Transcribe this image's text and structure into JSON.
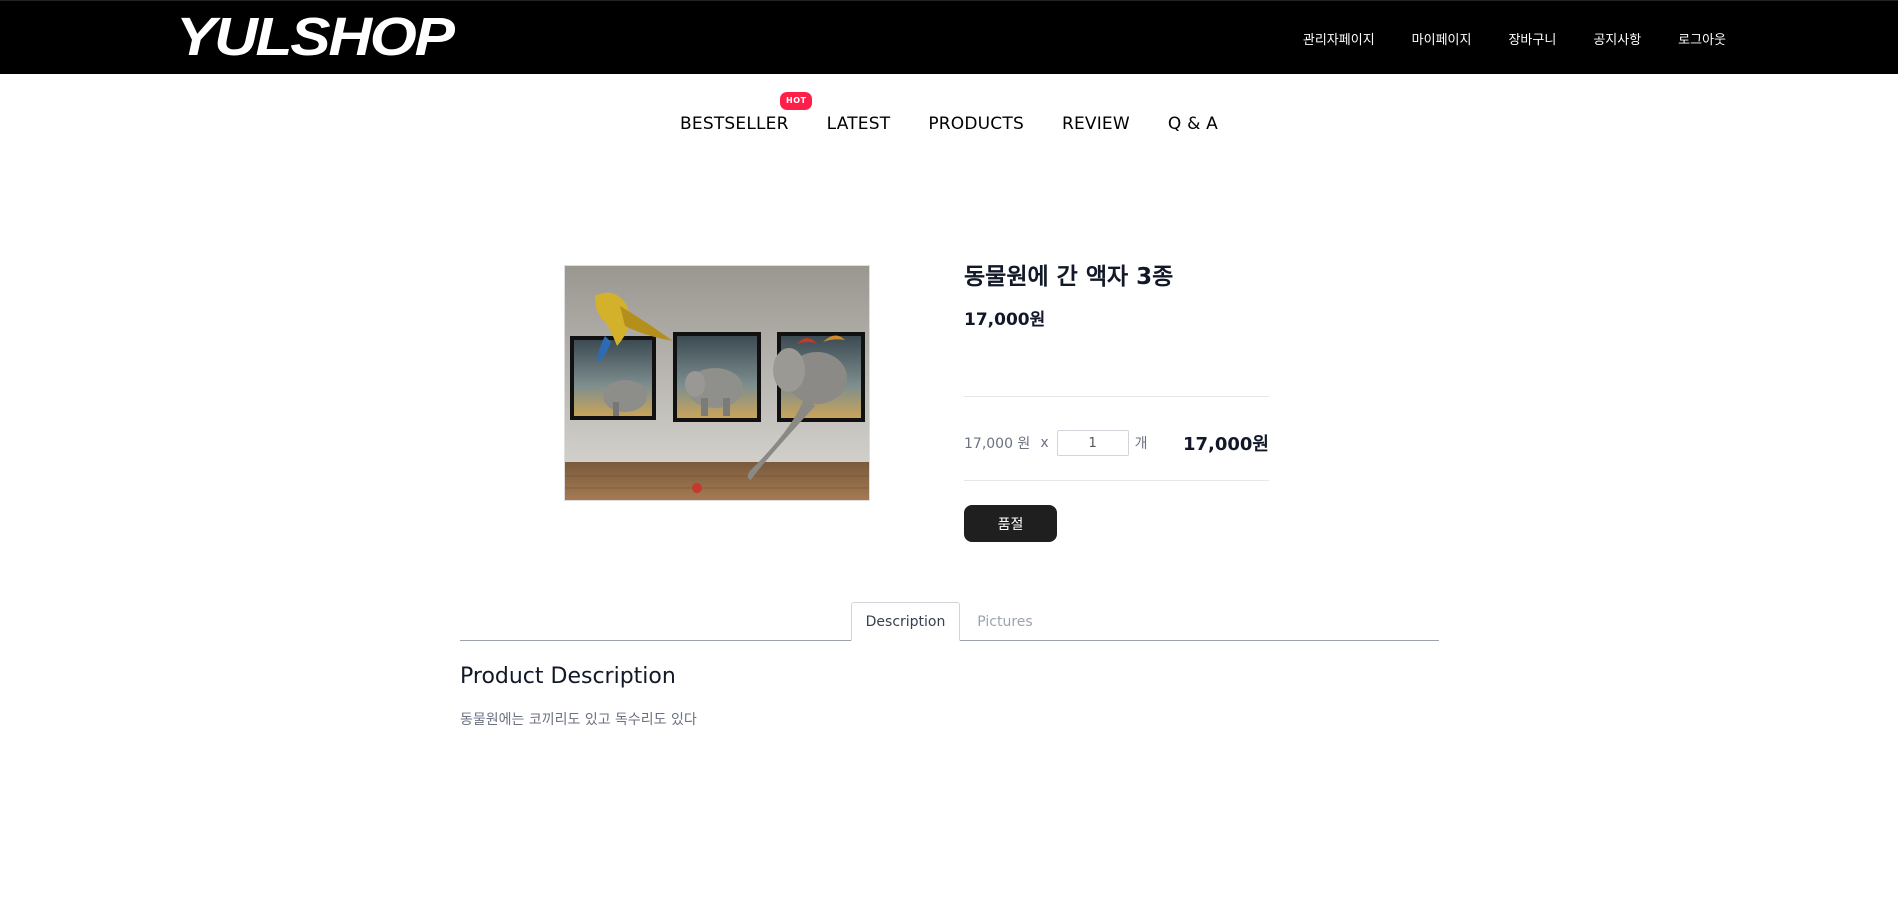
{
  "header": {
    "logo": "YULSHOP",
    "links": [
      "관리자페이지",
      "마이페이지",
      "장바구니",
      "공지사항",
      "로그아웃"
    ]
  },
  "nav": {
    "items": [
      "BESTSELLER",
      "LATEST",
      "PRODUCTS",
      "REVIEW",
      "Q & A"
    ],
    "hot_badge": "HOT"
  },
  "product": {
    "image_icon": "product-image",
    "title": "동물원에 간 액자 3종",
    "price": "17,000원",
    "unit_price": "17,000 원",
    "times": "x",
    "quantity": "1",
    "qty_unit": "개",
    "total": "17,000원",
    "soldout_label": "품절"
  },
  "tabs": {
    "description": "Description",
    "pictures": "Pictures"
  },
  "description": {
    "heading": "Product Description",
    "text": "동물원에는 코끼리도 있고 독수리도 있다"
  },
  "colors": {
    "topbar": "#000000",
    "hot_badge": "#ff1f4b",
    "soldout_button": "#1f1f1f"
  }
}
